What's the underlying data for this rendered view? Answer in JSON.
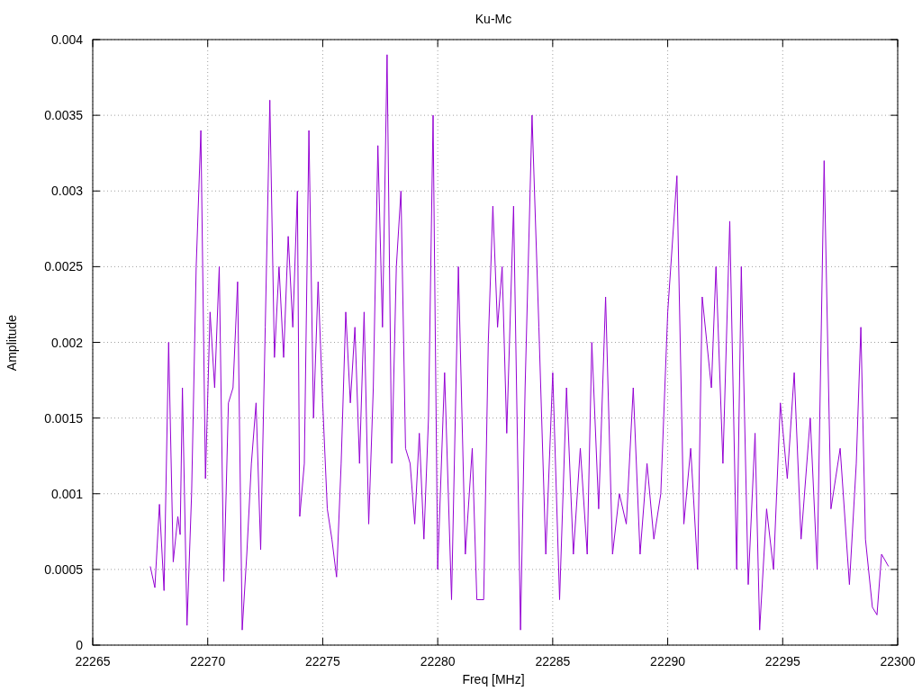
{
  "chart_data": {
    "type": "line",
    "title": "Ku-Mc",
    "xlabel": "Freq [MHz]",
    "ylabel": "Amplitude",
    "grid": true,
    "xlim": [
      22265,
      22300
    ],
    "ylim": [
      0,
      0.004
    ],
    "xticks": [
      22265,
      22270,
      22275,
      22280,
      22285,
      22290,
      22295,
      22300
    ],
    "yticks": [
      0,
      0.0005,
      0.001,
      0.0015,
      0.002,
      0.0025,
      0.003,
      0.0035,
      0.004
    ],
    "x": [
      22267.5,
      22267.7,
      22267.9,
      22268.1,
      22268.3,
      22268.5,
      22268.7,
      22268.8,
      22268.9,
      22269.1,
      22269.3,
      22269.5,
      22269.7,
      22269.9,
      22270.1,
      22270.3,
      22270.5,
      22270.7,
      22270.9,
      22271.1,
      22271.3,
      22271.5,
      22271.7,
      22271.9,
      22272.1,
      22272.3,
      22272.5,
      22272.7,
      22272.9,
      22273.1,
      22273.3,
      22273.5,
      22273.7,
      22273.9,
      22274.0,
      22274.2,
      22274.4,
      22274.6,
      22274.8,
      22275.0,
      22275.2,
      22275.4,
      22275.6,
      22275.8,
      22276.0,
      22276.2,
      22276.4,
      22276.6,
      22276.8,
      22277.0,
      22277.2,
      22277.4,
      22277.6,
      22277.8,
      22278.0,
      22278.2,
      22278.4,
      22278.6,
      22278.8,
      22279.0,
      22279.2,
      22279.4,
      22279.6,
      22279.8,
      22280.0,
      22280.3,
      22280.6,
      22280.9,
      22281.2,
      22281.5,
      22281.7,
      22282.0,
      22282.2,
      22282.4,
      22282.6,
      22282.8,
      22283.0,
      22283.3,
      22283.6,
      22283.8,
      22284.1,
      22284.4,
      22284.7,
      22285.0,
      22285.3,
      22285.6,
      22285.9,
      22286.2,
      22286.5,
      22286.7,
      22287.0,
      22287.3,
      22287.6,
      22287.9,
      22288.2,
      22288.5,
      22288.8,
      22289.1,
      22289.4,
      22289.7,
      22290.0,
      22290.4,
      22290.7,
      22291.0,
      22291.3,
      22291.5,
      22291.9,
      22292.1,
      22292.4,
      22292.7,
      22293.0,
      22293.2,
      22293.5,
      22293.8,
      22294.0,
      22294.3,
      22294.6,
      22294.9,
      22295.2,
      22295.5,
      22295.8,
      22296.2,
      22296.5,
      22296.8,
      22297.1,
      22297.5,
      22297.9,
      22298.2,
      22298.4,
      22298.6,
      22298.9,
      22299.1,
      22299.3,
      22299.6
    ],
    "series": [
      {
        "color": "#9400d3",
        "values": [
          0.00052,
          0.00038,
          0.00093,
          0.00036,
          0.002,
          0.00055,
          0.00085,
          0.00073,
          0.0017,
          0.00013,
          0.001,
          0.0025,
          0.0034,
          0.0011,
          0.0022,
          0.0017,
          0.0025,
          0.00042,
          0.0016,
          0.0017,
          0.0024,
          0.0001,
          0.0006,
          0.0012,
          0.0016,
          0.00063,
          0.0021,
          0.0036,
          0.0019,
          0.0025,
          0.0019,
          0.0027,
          0.0021,
          0.003,
          0.00085,
          0.0012,
          0.0034,
          0.0015,
          0.0024,
          0.0016,
          0.0009,
          0.0007,
          0.00045,
          0.0012,
          0.0022,
          0.0016,
          0.0021,
          0.0012,
          0.0022,
          0.0008,
          0.0017,
          0.0033,
          0.0021,
          0.0039,
          0.0012,
          0.0025,
          0.003,
          0.0013,
          0.0012,
          0.0008,
          0.0014,
          0.0007,
          0.0015,
          0.0035,
          0.0005,
          0.0018,
          0.0003,
          0.0025,
          0.0006,
          0.0013,
          0.0003,
          0.0003,
          0.002,
          0.0029,
          0.0021,
          0.0025,
          0.0014,
          0.0029,
          0.0001,
          0.0017,
          0.0035,
          0.0021,
          0.0006,
          0.0018,
          0.0003,
          0.0017,
          0.0006,
          0.0013,
          0.0006,
          0.002,
          0.0009,
          0.0023,
          0.0006,
          0.001,
          0.0008,
          0.0017,
          0.0006,
          0.0012,
          0.0007,
          0.001,
          0.0022,
          0.0031,
          0.0008,
          0.0013,
          0.0005,
          0.0023,
          0.0017,
          0.0025,
          0.0012,
          0.0028,
          0.0005,
          0.0025,
          0.0004,
          0.0014,
          0.0001,
          0.0009,
          0.0005,
          0.0016,
          0.0011,
          0.0018,
          0.0007,
          0.0015,
          0.0005,
          0.0032,
          0.0009,
          0.0013,
          0.0004,
          0.0012,
          0.0021,
          0.0007,
          0.00025,
          0.0002,
          0.0006,
          0.00052
        ]
      }
    ]
  }
}
